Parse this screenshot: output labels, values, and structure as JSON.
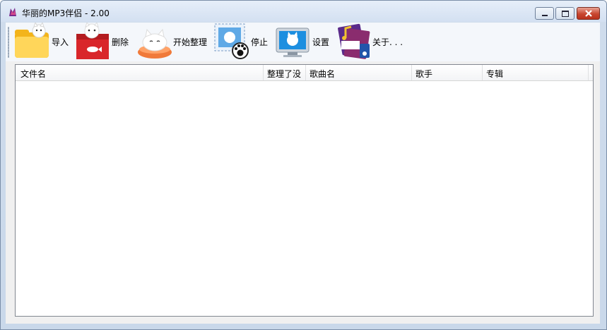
{
  "window": {
    "title": "华丽的MP3伴侣 - 2.00",
    "colors": {
      "frame": "#c9d8ea",
      "close_button": "#c8462f"
    }
  },
  "toolbar": {
    "items": [
      {
        "label": "导入",
        "icon": "folder-cat-icon"
      },
      {
        "label": "删除",
        "icon": "trash-cat-icon"
      },
      {
        "label": "开始整理",
        "icon": "cat-bed-icon"
      },
      {
        "label": "停止",
        "icon": "stamp-paw-icon"
      },
      {
        "label": "设置",
        "icon": "monitor-cat-icon"
      },
      {
        "label": "关于. . .",
        "icon": "mp3-player-icon"
      }
    ]
  },
  "list": {
    "columns": [
      "文件名",
      "整理了没",
      "歌曲名",
      "歌手",
      "专辑"
    ],
    "rows": []
  }
}
